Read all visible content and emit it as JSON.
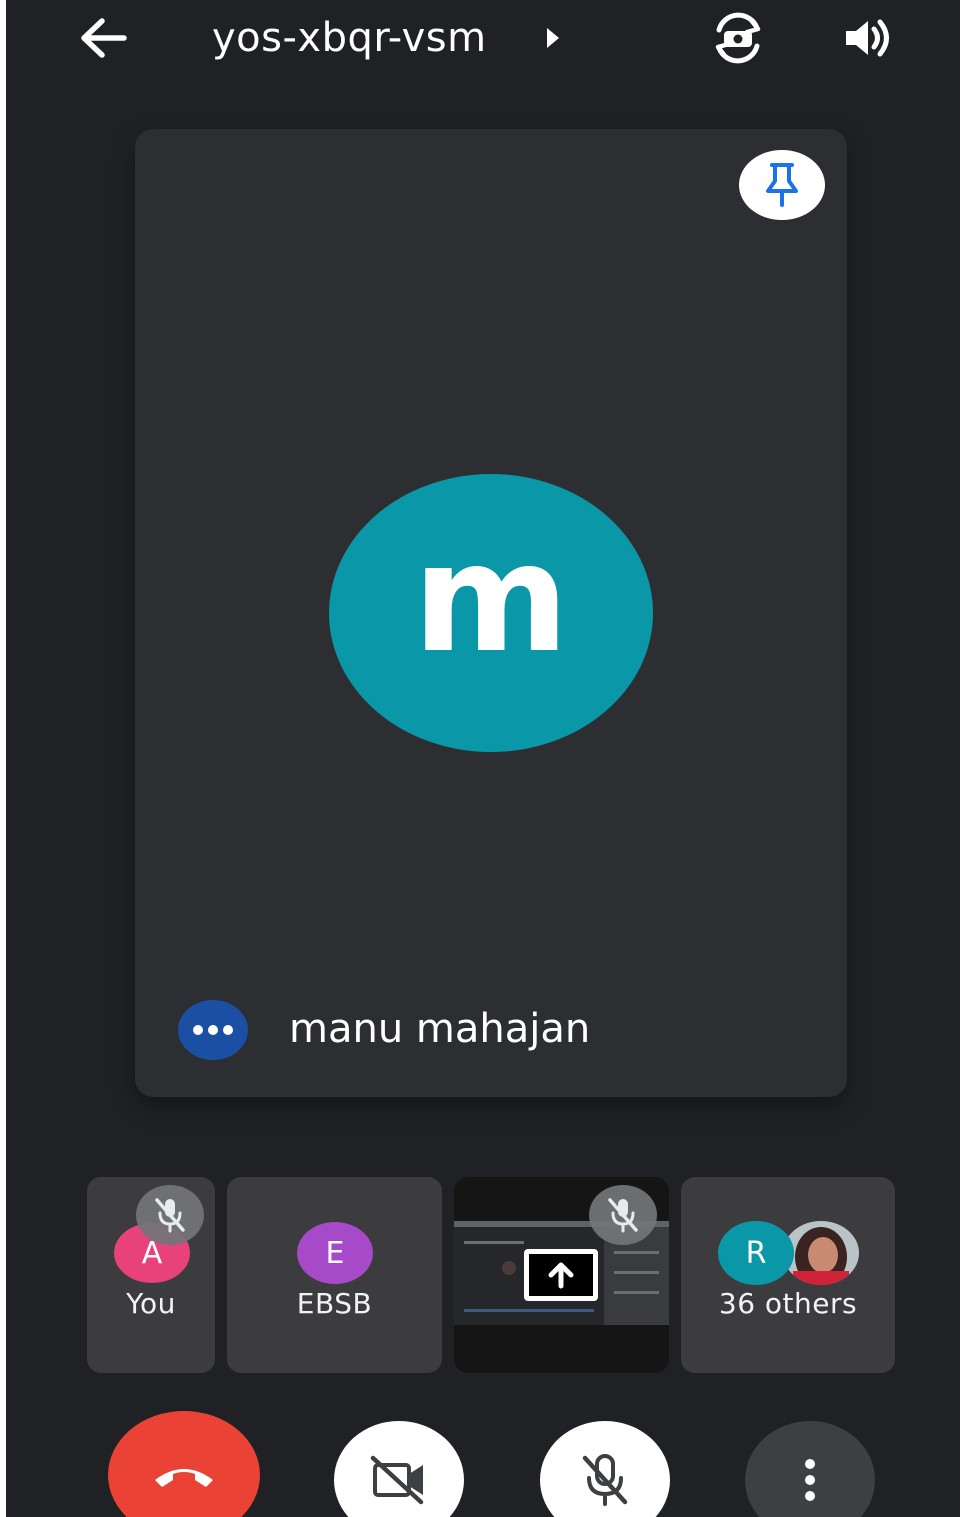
{
  "header": {
    "meeting_code": "yos-xbqr-vsm",
    "icons": [
      "arrow-back-icon",
      "caret-right-icon",
      "switch-camera-icon",
      "volume-icon"
    ]
  },
  "main_tile": {
    "avatar_letter": "m",
    "avatar_color": "#0a97a7",
    "participant_name": "manu mahajan",
    "icons": [
      "pin-icon",
      "more-options-icon"
    ]
  },
  "thumbnails": [
    {
      "id": "you",
      "avatar_letter": "A",
      "avatar_color": "#e8427b",
      "label": "You",
      "muted": true
    },
    {
      "id": "ebsb",
      "avatar_letter": "E",
      "avatar_color": "#a64ac9",
      "label": "EBSB",
      "muted": false
    },
    {
      "id": "screen-share",
      "label": "",
      "muted": true
    },
    {
      "id": "others",
      "avatar_letter": "R",
      "avatar_color": "#0a97a7",
      "label": "36 others"
    }
  ],
  "controls": {
    "end_call_color": "#ea4335",
    "icons": [
      "end-call-icon",
      "camera-off-icon",
      "mic-off-icon",
      "more-vertical-icon"
    ]
  }
}
